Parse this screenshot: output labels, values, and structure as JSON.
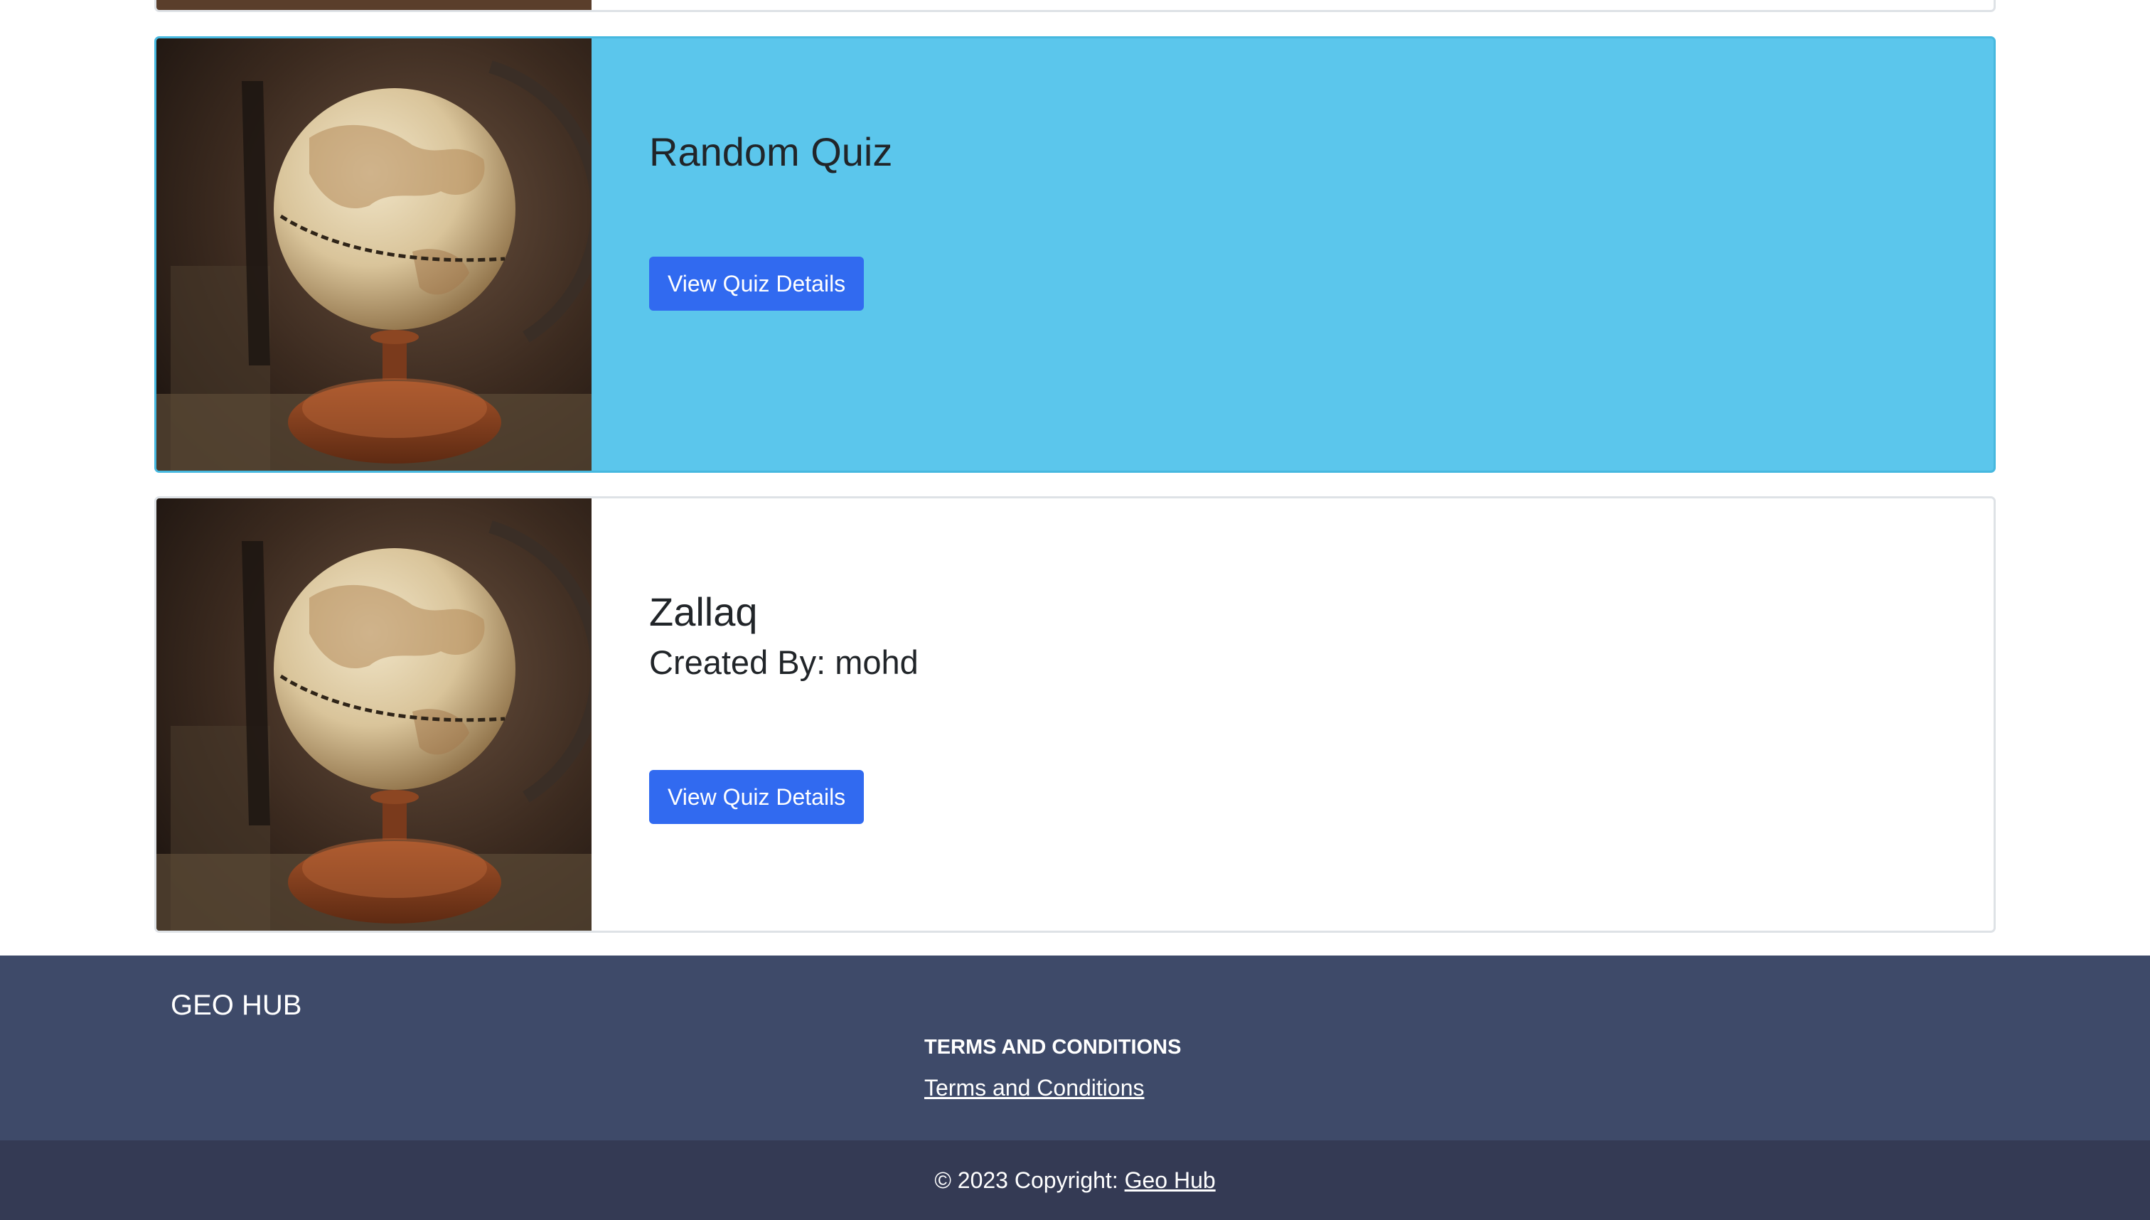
{
  "quizzes": [
    {
      "title": "Random Quiz",
      "creator_line": "",
      "button_label": "View Quiz Details",
      "highlighted": true
    },
    {
      "title": "Zallaq",
      "creator_line": "Created By: mohd",
      "button_label": "View Quiz Details",
      "highlighted": false
    }
  ],
  "image_icon": "globe-photo",
  "colors": {
    "highlight_card": "#5bc6ec",
    "button": "#316af0",
    "footer": "#3e4a69",
    "footer_bottom": "#343a54"
  },
  "footer": {
    "brand": "GEO HUB",
    "terms_heading": "TERMS AND CONDITIONS",
    "terms_link": "Terms and Conditions",
    "copyright_prefix": "© 2023 Copyright:",
    "copyright_link": "Geo Hub"
  }
}
